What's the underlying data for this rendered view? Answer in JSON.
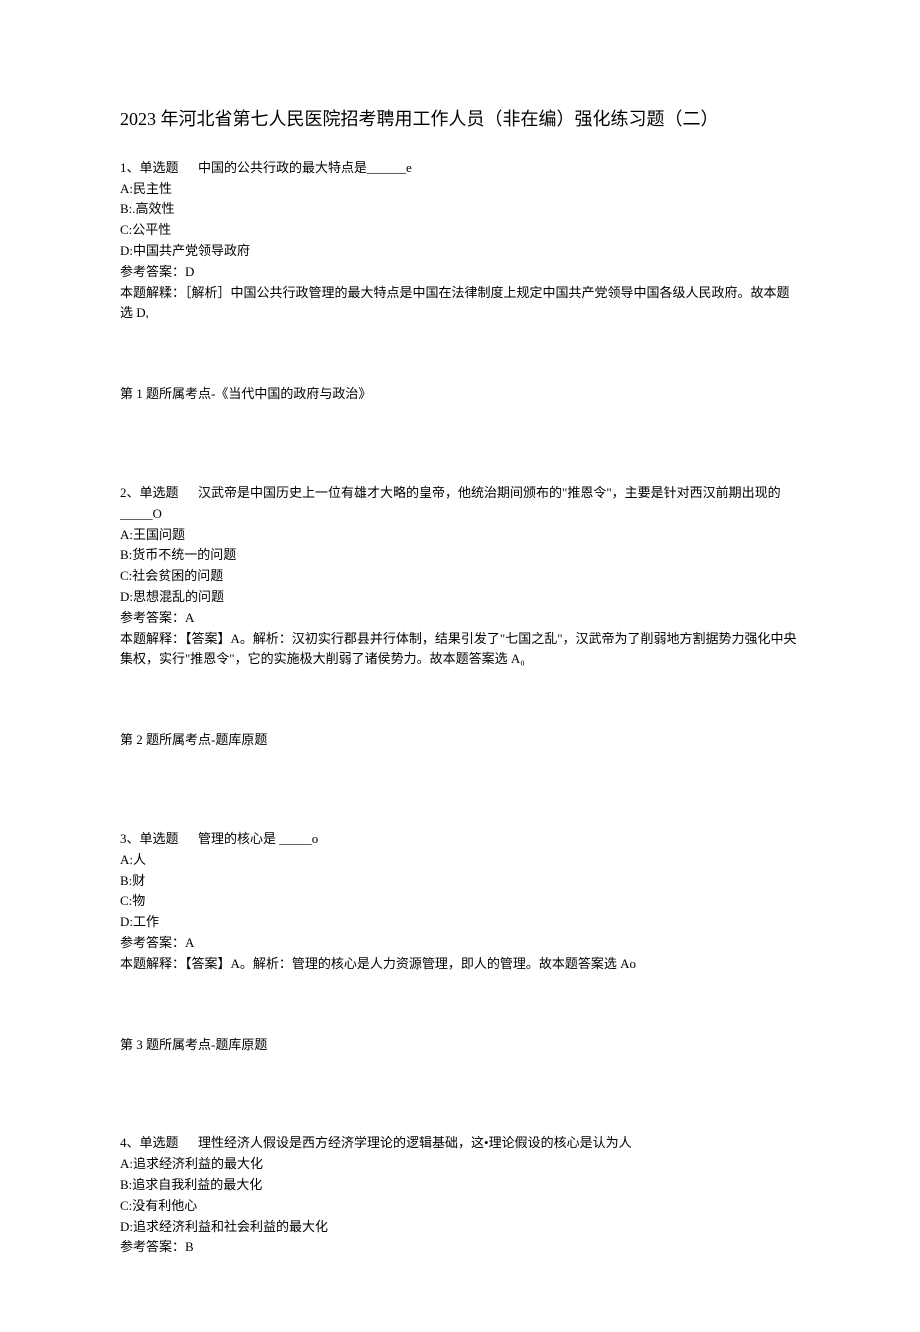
{
  "title": "2023 年河北省第七人民医院招考聘用工作人员（非在编）强化练习题（二）",
  "q1": {
    "stem_label": "1、单选题",
    "stem_text": "中国的公共行政的最大特点是______e",
    "opt_a": "A:民主性",
    "opt_b": "B:.高效性",
    "opt_c": "C:公平性",
    "opt_d": "D:中国共产党领导政府",
    "answer": "参考答案：D",
    "explain": "本题解糅：［解析］中国公共行政管理的最大特点是中国在法律制度上规定中国共产党领导中国各级人民政府。故本题选 D,",
    "topic": "第 1 题所属考点-《当代中国的政府与政治》"
  },
  "q2": {
    "stem_label": "2、单选题",
    "stem_text": "汉武帝是中国历史上一位有雄才大略的皇帝，他统治期间颁布的\"推恩令\"，主要是针对西汉前期出现的_____O",
    "opt_a": "A:王国问题",
    "opt_b": "B:货币不统一的问题",
    "opt_c": "C:社会贫困的问题",
    "opt_d": "D:思想混乱的问题",
    "answer": "参考答案：A",
    "explain": "本题解释：【答案】A。解析：汉初实行郡县并行体制，结果引发了\"七国之乱\"，汉武帝为了削弱地方割据势力强化中央集权，实行\"推恩令\"，它的实施极大削弱了诸侯势力。故本题答案选 A₀",
    "topic": "第 2 题所属考点-题库原题"
  },
  "q3": {
    "stem_label": "3、单选题",
    "stem_text": "管理的核心是 _____o",
    "opt_a": "A:人",
    "opt_b": "B:财",
    "opt_c": "C:物",
    "opt_d": "D:工作",
    "answer": "参考答案：A",
    "explain": "本题解释：【答案】A。解析：管理的核心是人力资源管理，即人的管理。故本题答案选 Ao",
    "topic": "第 3 题所属考点-题库原题"
  },
  "q4": {
    "stem_label": "4、单选题",
    "stem_text": "理性经济人假设是西方经济学理论的逻辑基础，这•理论假设的核心是认为人",
    "opt_a": "A:追求经济利益的最大化",
    "opt_b": "B:追求自我利益的最大化",
    "opt_c": "C:没有利他心",
    "opt_d": "D:追求经济利益和社会利益的最大化",
    "answer": "参考答案：B"
  }
}
